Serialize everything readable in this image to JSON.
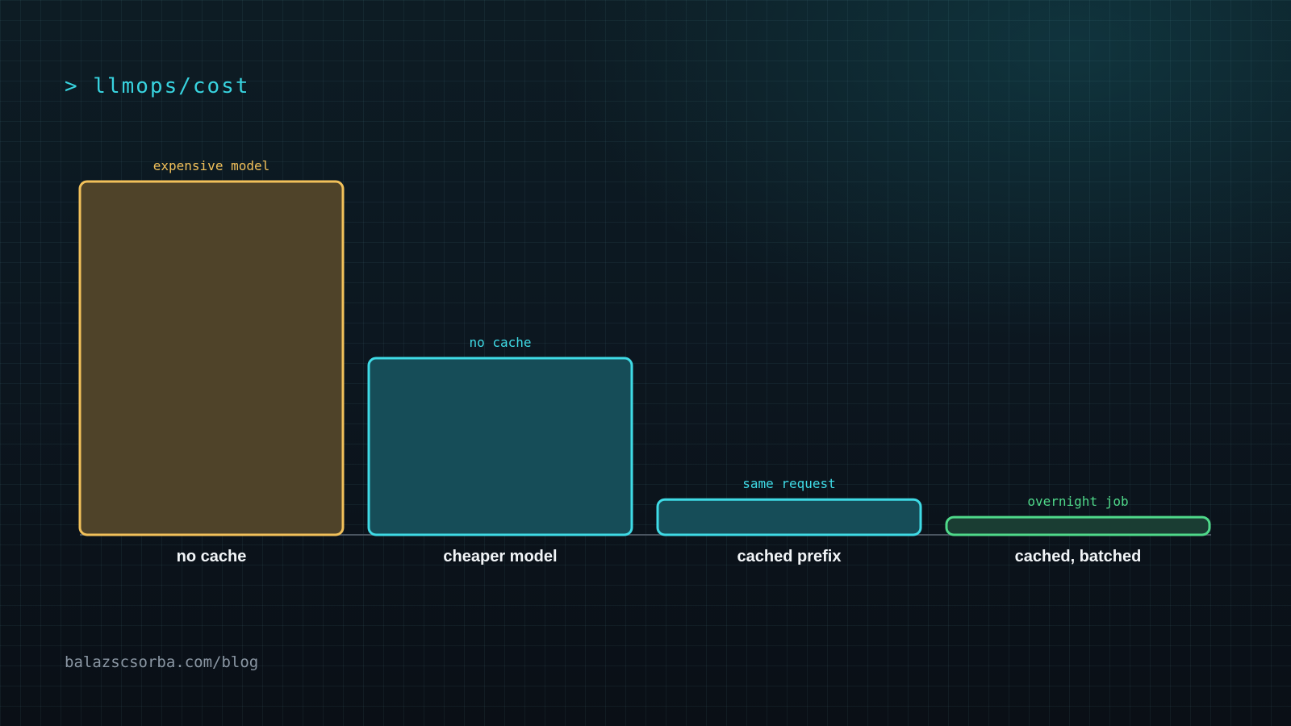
{
  "header": {
    "prompt": "> llmops/cost"
  },
  "footer": {
    "url": "balazscsorba.com/blog"
  },
  "chart_data": {
    "type": "bar",
    "title": "",
    "xlabel": "",
    "ylabel": "",
    "grid": true,
    "ylim": [
      0,
      100
    ],
    "categories": [
      "no cache",
      "cheaper model",
      "cached prefix",
      "cached, batched"
    ],
    "values": [
      100,
      50,
      10,
      5
    ],
    "annotations": [
      "expensive model",
      "no cache",
      "same request",
      "overnight job"
    ],
    "colors": [
      "#f2c15a",
      "#3fdbe6",
      "#3fdbe6",
      "#4fd98a"
    ],
    "fills": [
      "#4f4329",
      "#164d58",
      "#164d58",
      "#1a3d33"
    ]
  }
}
